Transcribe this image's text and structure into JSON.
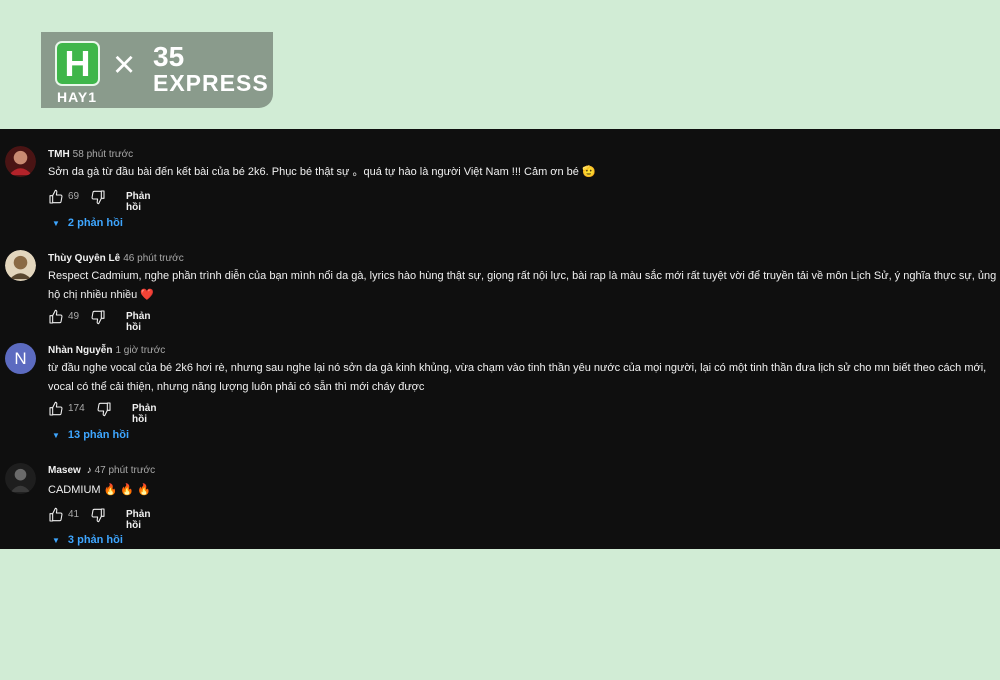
{
  "logo": {
    "mark_letter": "H",
    "brand_text": "HAY1",
    "cross": "×",
    "partner_number": "35",
    "partner_word": "EXPRESS"
  },
  "colors": {
    "page_bg": "#d1ecd5",
    "panel_bg": "#0f0f0f",
    "link_blue": "#3ea6ff",
    "logo_bg": "#8a9b8c",
    "logo_green": "#3fb64a"
  },
  "reply_label": "Phản hồi",
  "comments": [
    {
      "name": "TMH",
      "time": "58 phút trước",
      "text": "Sởn da gà từ đầu bài đến kết bài của bé 2k6. Phục bé thật sự 。quá tự hào là người Việt Nam !!!  Cảm ơn bé 🫡",
      "likes": "69",
      "replies": "2 phản hồi"
    },
    {
      "name": "Thùy Quyên Lê",
      "time": "46 phút trước",
      "text": "Respect Cadmium, nghe phần trình diễn của bạn mình nổi da gà, lyrics hào hùng thật sự, giọng rất nội lực, bài rap là màu sắc mới rất tuyệt vời để truyền tải về môn Lịch Sử, ý nghĩa thực sự, ủng hộ chị nhiều nhiều ❤️",
      "likes": "49"
    },
    {
      "name": "Nhàn Nguyễn",
      "time": "1 giờ trước",
      "avatar_letter": "N",
      "text": "từ đầu nghe vocal của bé 2k6 hơi rè, nhưng sau nghe lại nó sởn da gà kinh khủng, vừa chạm vào tinh thần yêu nước của mọi người, lại có một tinh thần đưa lịch sử cho mn biết theo cách mới, vocal có thể cải thiện, nhưng năng lượng luôn phải có sẵn thì mới cháy được",
      "likes": "174",
      "replies": "13 phản hồi"
    },
    {
      "name": "Masew",
      "name_badge": "♪",
      "time": "47 phút trước",
      "text": "CADMIUM 🔥 🔥 🔥",
      "likes": "41",
      "replies": "3 phản hồi"
    }
  ]
}
